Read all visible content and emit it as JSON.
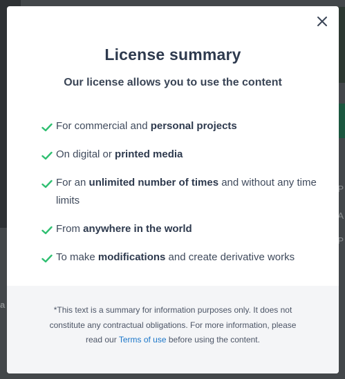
{
  "modal": {
    "title": "License summary",
    "subtitle": "Our license allows you to use the content",
    "items": [
      {
        "pre": "For commercial and ",
        "bold": "personal projects",
        "post": ""
      },
      {
        "pre": "On digital or ",
        "bold": "printed media",
        "post": ""
      },
      {
        "pre": "For an ",
        "bold": "unlimited number of times",
        "post": " and without any time limits"
      },
      {
        "pre": "From ",
        "bold": "anywhere in the world",
        "post": ""
      },
      {
        "pre": "To make ",
        "bold": "modifications",
        "post": " and create derivative works"
      }
    ],
    "footer": {
      "pre": "*This text is a summary for information purposes only. It does not constitute any contractual obligations. For more information, please read our ",
      "link": "Terms of use",
      "post": " before using the content."
    },
    "close_icon": "close-icon",
    "check_icon": "check-icon"
  },
  "background": {
    "left_text": "a",
    "right_texts": [
      "P",
      "A",
      "P"
    ]
  },
  "colors": {
    "check": "#2fbf71",
    "title": "#2e3a4e",
    "link": "#1a76c9",
    "footer_bg": "#f4f5f7"
  }
}
